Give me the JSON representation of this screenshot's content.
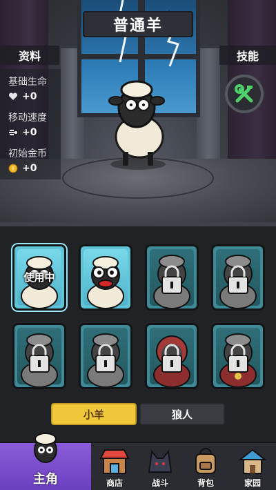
{
  "header": {
    "title": "普通羊"
  },
  "left_tab": "资料",
  "right_tab": "技能",
  "stats": [
    {
      "name": "基础生命",
      "icon": "heart-icon",
      "value": "+0"
    },
    {
      "name": "移动速度",
      "icon": "speed-icon",
      "value": "+0"
    },
    {
      "name": "初始金币",
      "icon": "coin-icon",
      "value": "+0"
    }
  ],
  "grid": {
    "in_use_label": "使用中"
  },
  "segments": {
    "sheep": "小羊",
    "wolf": "狼人"
  },
  "nav": {
    "main": "主角",
    "shop": "商店",
    "battle": "战斗",
    "bag": "背包",
    "home": "家园"
  },
  "colors": {
    "accent": "#f0c83c",
    "card_active": "#5fc4d8",
    "nav_active": "#7a4fd0"
  }
}
